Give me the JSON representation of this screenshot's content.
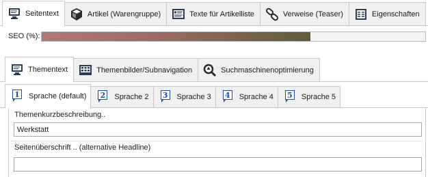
{
  "top_tabs": [
    {
      "label": "Seitentext",
      "icon": "monitor-icon",
      "active": true
    },
    {
      "label": "Artikel (Warengruppe)",
      "icon": "cube-icon",
      "active": false
    },
    {
      "label": "Texte für Artikelliste",
      "icon": "text-list-icon",
      "active": false
    },
    {
      "label": "Verweise (Teaser)",
      "icon": "link-icon",
      "active": false
    },
    {
      "label": "Eigenschaften",
      "icon": "properties-icon",
      "active": false
    }
  ],
  "seo": {
    "label": "SEO (%):",
    "progress_fraction": 0.7,
    "bar_color_start": "#b07878",
    "bar_color_end": "#5e5c36"
  },
  "sub_tabs": [
    {
      "label": "Thementext",
      "icon": "monitor-icon",
      "active": true
    },
    {
      "label": "Themenbilder/Subnavigation",
      "icon": "image-grid-icon",
      "active": false
    },
    {
      "label": "Suchmaschinenoptimierung",
      "icon": "magnifier-icon",
      "active": false
    }
  ],
  "language_tabs": [
    {
      "num": "1",
      "label": "Sprache (default)",
      "active": true
    },
    {
      "num": "2",
      "label": "Sprache 2",
      "active": false
    },
    {
      "num": "3",
      "label": "Sprache 3",
      "active": false
    },
    {
      "num": "4",
      "label": "Sprache 4",
      "active": false
    },
    {
      "num": "5",
      "label": "Sprache 5",
      "active": false
    }
  ],
  "fields": {
    "short_description": {
      "label": "Themenkurzbeschreibung..",
      "value": "Werkstatt"
    },
    "headline": {
      "label": "Seitenüberschrift .. (alternative Headline)",
      "value": ""
    }
  },
  "colors": {
    "accent_blue": "#1f4aa8",
    "tab_border": "#c8c8c8"
  }
}
